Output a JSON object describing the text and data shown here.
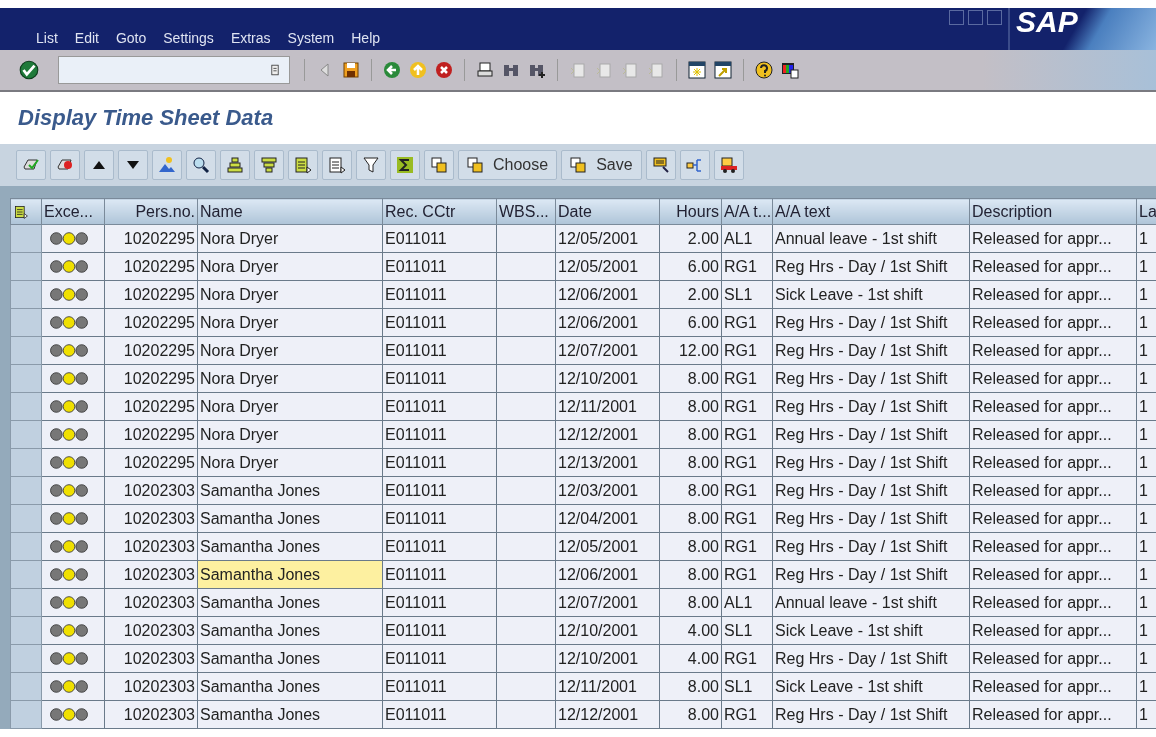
{
  "menu": [
    "List",
    "Edit",
    "Goto",
    "Settings",
    "Extras",
    "System",
    "Help"
  ],
  "logo": "SAP",
  "title": "Display Time Sheet Data",
  "app_buttons": [
    "Choose",
    "Save"
  ],
  "columns": [
    "Exce...",
    "Pers.no.",
    "Name",
    "Rec. CCtr",
    "WBS...",
    "Date",
    "Hours",
    "A/A t...",
    "A/A text",
    "Description",
    "La"
  ],
  "rows": [
    {
      "color": "#f0e000",
      "pers": "10202295",
      "name": "Nora Dryer",
      "cctr": "E011011",
      "date": "12/05/2001",
      "hours": "2.00",
      "aat": "AL1",
      "aatext": "Annual leave - 1st shift",
      "desc": "Released for appr...",
      "col_11": "1",
      "selected": false
    },
    {
      "color": "#f0e000",
      "pers": "10202295",
      "name": "Nora Dryer",
      "cctr": "E011011",
      "date": "12/05/2001",
      "hours": "6.00",
      "aat": "RG1",
      "aatext": "Reg Hrs - Day / 1st Shift",
      "desc": "Released for appr...",
      "col_11": "1",
      "selected": false
    },
    {
      "color": "#f0e000",
      "pers": "10202295",
      "name": "Nora Dryer",
      "cctr": "E011011",
      "date": "12/06/2001",
      "hours": "2.00",
      "aat": "SL1",
      "aatext": "Sick Leave - 1st shift",
      "desc": "Released for appr...",
      "col_11": "1",
      "selected": false
    },
    {
      "color": "#f0e000",
      "pers": "10202295",
      "name": "Nora Dryer",
      "cctr": "E011011",
      "date": "12/06/2001",
      "hours": "6.00",
      "aat": "RG1",
      "aatext": "Reg Hrs - Day / 1st Shift",
      "desc": "Released for appr...",
      "col_11": "1",
      "selected": false
    },
    {
      "color": "#f0e000",
      "pers": "10202295",
      "name": "Nora Dryer",
      "cctr": "E011011",
      "date": "12/07/2001",
      "hours": "12.00",
      "aat": "RG1",
      "aatext": "Reg Hrs - Day / 1st Shift",
      "desc": "Released for appr...",
      "col_11": "1",
      "selected": false
    },
    {
      "color": "#f0e000",
      "pers": "10202295",
      "name": "Nora Dryer",
      "cctr": "E011011",
      "date": "12/10/2001",
      "hours": "8.00",
      "aat": "RG1",
      "aatext": "Reg Hrs - Day / 1st Shift",
      "desc": "Released for appr...",
      "col_11": "1",
      "selected": false
    },
    {
      "color": "#f0e000",
      "pers": "10202295",
      "name": "Nora Dryer",
      "cctr": "E011011",
      "date": "12/11/2001",
      "hours": "8.00",
      "aat": "RG1",
      "aatext": "Reg Hrs - Day / 1st Shift",
      "desc": "Released for appr...",
      "col_11": "1",
      "selected": false
    },
    {
      "color": "#f0e000",
      "pers": "10202295",
      "name": "Nora Dryer",
      "cctr": "E011011",
      "date": "12/12/2001",
      "hours": "8.00",
      "aat": "RG1",
      "aatext": "Reg Hrs - Day / 1st Shift",
      "desc": "Released for appr...",
      "col_11": "1",
      "selected": false
    },
    {
      "color": "#f0e000",
      "pers": "10202295",
      "name": "Nora Dryer",
      "cctr": "E011011",
      "date": "12/13/2001",
      "hours": "8.00",
      "aat": "RG1",
      "aatext": "Reg Hrs - Day / 1st Shift",
      "desc": "Released for appr...",
      "col_11": "1",
      "selected": false
    },
    {
      "color": "#f0e000",
      "pers": "10202303",
      "name": "Samantha Jones",
      "cctr": "E011011",
      "date": "12/03/2001",
      "hours": "8.00",
      "aat": "RG1",
      "aatext": "Reg Hrs - Day / 1st Shift",
      "desc": "Released for appr...",
      "col_11": "1",
      "selected": false
    },
    {
      "color": "#f0e000",
      "pers": "10202303",
      "name": "Samantha Jones",
      "cctr": "E011011",
      "date": "12/04/2001",
      "hours": "8.00",
      "aat": "RG1",
      "aatext": "Reg Hrs - Day / 1st Shift",
      "desc": "Released for appr...",
      "col_11": "1",
      "selected": false
    },
    {
      "color": "#f0e000",
      "pers": "10202303",
      "name": "Samantha Jones",
      "cctr": "E011011",
      "date": "12/05/2001",
      "hours": "8.00",
      "aat": "RG1",
      "aatext": "Reg Hrs - Day / 1st Shift",
      "desc": "Released for appr...",
      "col_11": "1",
      "selected": false
    },
    {
      "color": "#f0e000",
      "pers": "10202303",
      "name": "Samantha Jones",
      "cctr": "E011011",
      "date": "12/06/2001",
      "hours": "8.00",
      "aat": "RG1",
      "aatext": "Reg Hrs - Day / 1st Shift",
      "desc": "Released for appr...",
      "col_11": "1",
      "selected": true
    },
    {
      "color": "#f0e000",
      "pers": "10202303",
      "name": "Samantha Jones",
      "cctr": "E011011",
      "date": "12/07/2001",
      "hours": "8.00",
      "aat": "AL1",
      "aatext": "Annual leave - 1st shift",
      "desc": "Released for appr...",
      "col_11": "1",
      "selected": false
    },
    {
      "color": "#f0e000",
      "pers": "10202303",
      "name": "Samantha Jones",
      "cctr": "E011011",
      "date": "12/10/2001",
      "hours": "4.00",
      "aat": "SL1",
      "aatext": "Sick Leave - 1st shift",
      "desc": "Released for appr...",
      "col_11": "1",
      "selected": false
    },
    {
      "color": "#f0e000",
      "pers": "10202303",
      "name": "Samantha Jones",
      "cctr": "E011011",
      "date": "12/10/2001",
      "hours": "4.00",
      "aat": "RG1",
      "aatext": "Reg Hrs - Day / 1st Shift",
      "desc": "Released for appr...",
      "col_11": "1",
      "selected": false
    },
    {
      "color": "#f0e000",
      "pers": "10202303",
      "name": "Samantha Jones",
      "cctr": "E011011",
      "date": "12/11/2001",
      "hours": "8.00",
      "aat": "SL1",
      "aatext": "Sick Leave - 1st shift",
      "desc": "Released for appr...",
      "col_11": "1",
      "selected": false
    },
    {
      "color": "#f0e000",
      "pers": "10202303",
      "name": "Samantha Jones",
      "cctr": "E011011",
      "date": "12/12/2001",
      "hours": "8.00",
      "aat": "RG1",
      "aatext": "Reg Hrs - Day / 1st Shift",
      "desc": "Released for appr...",
      "col_11": "1",
      "selected": false
    }
  ]
}
